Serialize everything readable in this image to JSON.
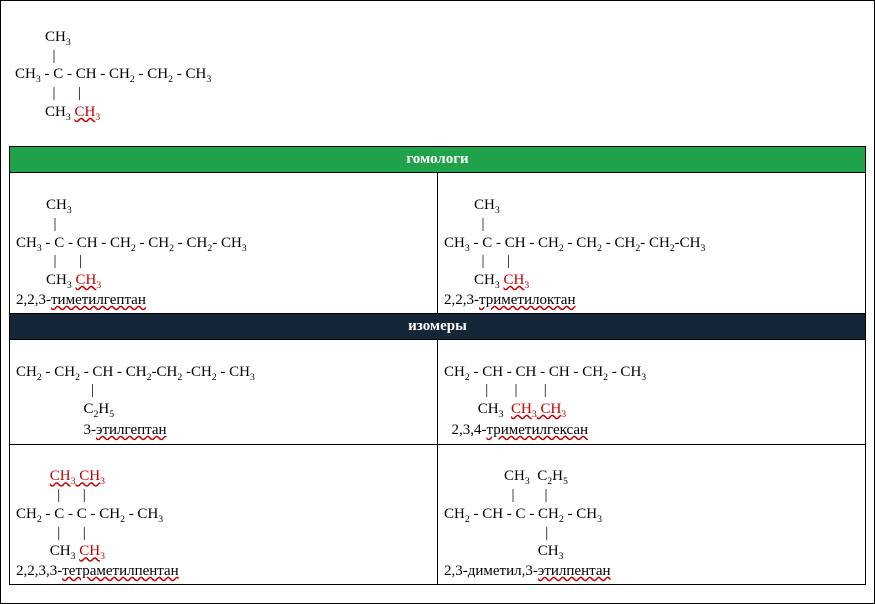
{
  "top_formula": {
    "line1": "        CH3",
    "line2": "          |",
    "line3": "CH3 - C - CH - CH2 - CH2 - CH3",
    "line4": "          |      |",
    "line5_a": "        CH3 ",
    "line5_b": "CH3"
  },
  "headers": {
    "homologs": "гомологи",
    "isomers": "изомеры"
  },
  "cells": {
    "h1": {
      "l1": "        CH3",
      "l2": "          |",
      "l3": "CH3 - C - CH - CH2 - CH2 - CH2- CH3",
      "l4": "          |      |",
      "l5a": "        CH3 ",
      "l5b": "CH3",
      "name_a": "2,2,3-",
      "name_b": "тиметилгептан"
    },
    "h2": {
      "l1": "        CH3",
      "l2": "          |",
      "l3": "CH3 - C - CH - CH2 - CH2 - CH2- CH2-CH3",
      "l4": "          |      |",
      "l5a": "        CH3 ",
      "l5b": "CH3",
      "name_a": "2,2,3-",
      "name_b": "триметилоктан"
    },
    "i1": {
      "l1": "CH2 - CH2 - CH - CH2-CH2 -CH2 - CH3",
      "l2": "                    |",
      "l3": "                  C2H5",
      "name_pre": "                  3-",
      "name_b": "этилгептан"
    },
    "i2": {
      "l1": "CH2 - CH - CH - CH - CH2 - CH3",
      "l2": "           |       |       |",
      "l3a": "         CH3  ",
      "l3b": "CH3 CH3",
      "name_pre": "  2,3,4-",
      "name_b": "триметилгексан"
    },
    "i3": {
      "l1a": "         ",
      "l1b": "CH3 CH3",
      "l2": "           |      |",
      "l3": "CH2 - C - C - CH2 - CH3",
      "l4": "           |      |",
      "l5a": "         CH3 ",
      "l5b": "CH3",
      "name_a": "2,2,3,3-",
      "name_b": "тетраметилпентан"
    },
    "i4": {
      "l1": "                CH3  C2H5",
      "l2": "                  |        |",
      "l3": "CH2 - CH - C - CH2 - CH3",
      "l4": "                           |",
      "l5": "                         CH3",
      "name_a": "2,3-диметил,3-",
      "name_b": "этилпентан"
    }
  }
}
